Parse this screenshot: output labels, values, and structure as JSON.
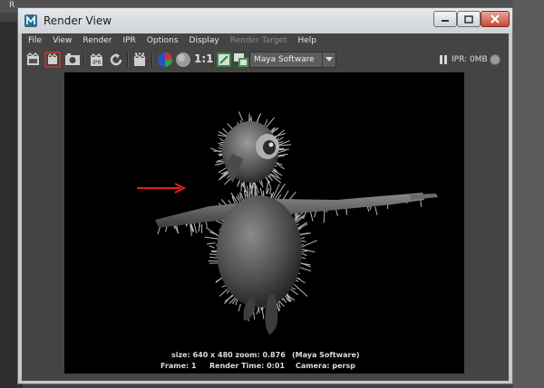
{
  "background": {
    "corner_letter": "R"
  },
  "window": {
    "title": "Render View",
    "controls": {
      "minimize": "minimize",
      "maximize": "maximize",
      "close": "close"
    }
  },
  "menubar": {
    "items": [
      {
        "label": "File",
        "enabled": true
      },
      {
        "label": "View",
        "enabled": true
      },
      {
        "label": "Render",
        "enabled": true
      },
      {
        "label": "IPR",
        "enabled": true
      },
      {
        "label": "Options",
        "enabled": true
      },
      {
        "label": "Display",
        "enabled": true
      },
      {
        "label": "Render Target",
        "enabled": false
      },
      {
        "label": "Help",
        "enabled": true
      }
    ]
  },
  "toolbar": {
    "ratio_label": "1:1",
    "renderer": "Maya Software",
    "ipr_status": "IPR: 0MB",
    "icons": [
      "render-frame-icon",
      "render-region-icon",
      "snapshot-icon",
      "ipr-render-icon",
      "refresh-icon",
      "render-settings-icon",
      "color-channel-icon",
      "alpha-channel-icon",
      "display-real-size-label",
      "keep-image-icon",
      "remove-image-icon"
    ]
  },
  "viewport": {
    "size_zoom": "size: 640 x 480  zoom: 0.876",
    "renderer_tag": "(Maya Software)",
    "frame": "Frame: 1",
    "render_time": "Render Time: 0:01",
    "camera": "Camera: persp"
  },
  "colors": {
    "titlebar": "#dcdfe3",
    "client_bg": "#444444",
    "viewport_bg": "#000000",
    "annotation_arrow": "#e0201e"
  }
}
